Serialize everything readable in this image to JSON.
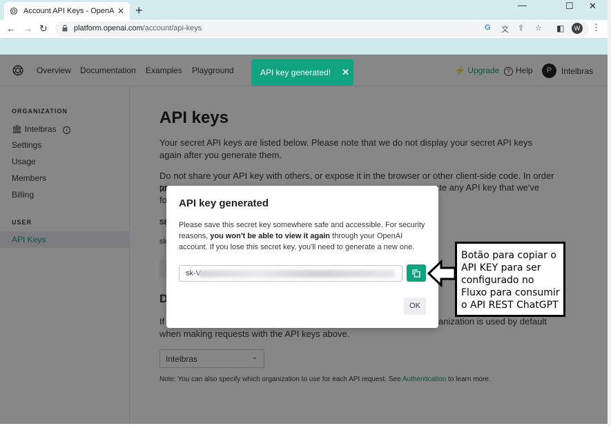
{
  "browser": {
    "tab_title": "Account API Keys - OpenAI API",
    "tab_close": "✕",
    "new_tab": "+",
    "win_min": "—",
    "win_max": "☐",
    "win_close": "✕",
    "url_host": "platform.openai.com",
    "url_path": "/account/api-keys",
    "profile_initial": "W",
    "menu": "⋮"
  },
  "nav": {
    "items": [
      "Overview",
      "Documentation",
      "Examples",
      "Playground"
    ],
    "toast_text": "API key generated!",
    "toast_close": "✕",
    "upgrade": "Upgrade",
    "help": "Help",
    "help_icon": "?",
    "user_initial": "P",
    "user_name": "Intelbras"
  },
  "sidebar": {
    "org_heading": "ORGANIZATION",
    "org_name": "Intelbras",
    "org_info_icon": "i",
    "items": [
      "Settings",
      "Usage",
      "Members",
      "Billing"
    ],
    "user_heading": "USER",
    "active_item": "API Keys"
  },
  "main": {
    "title": "API keys",
    "para1": "Your secret API keys are listed below. Please note that we do not display your secret API keys again after you generate them.",
    "para2_line1": "Do not share your API key with others, or expose it in the browser or other client-side code. In order to",
    "para2_frag_a": "pr",
    "para2_frag_b": "ate any API key that we've",
    "para2_frag_c": "fo",
    "table_frag": "SE",
    "row_frag": "sk",
    "section_frag": "D",
    "para3_frag": "If",
    "para3_end": "anization is used by default",
    "para3_line2": "when making requests with the API keys above.",
    "org_select_value": "Intelbras",
    "note_text": "Note: You can also specify which organization to use for each API request. See ",
    "note_link": "Authentication",
    "note_end": " to learn more."
  },
  "modal": {
    "title": "API key generated",
    "desc_before": "Please save this secret key somewhere safe and accessible. For security reasons, ",
    "desc_bold": "you won't be able to view it again",
    "desc_after": " through your OpenAI account. If you lose this secret key, you'll need to generate a new one.",
    "key_prefix": "sk-V",
    "ok_label": "OK"
  },
  "annotation": {
    "text": "Botão para copiar o API KEY para ser configurado no Fluxo para consumir o API REST ChatGPT"
  },
  "colors": {
    "accent": "#10a37f",
    "tab_strip": "#d4ecef"
  }
}
